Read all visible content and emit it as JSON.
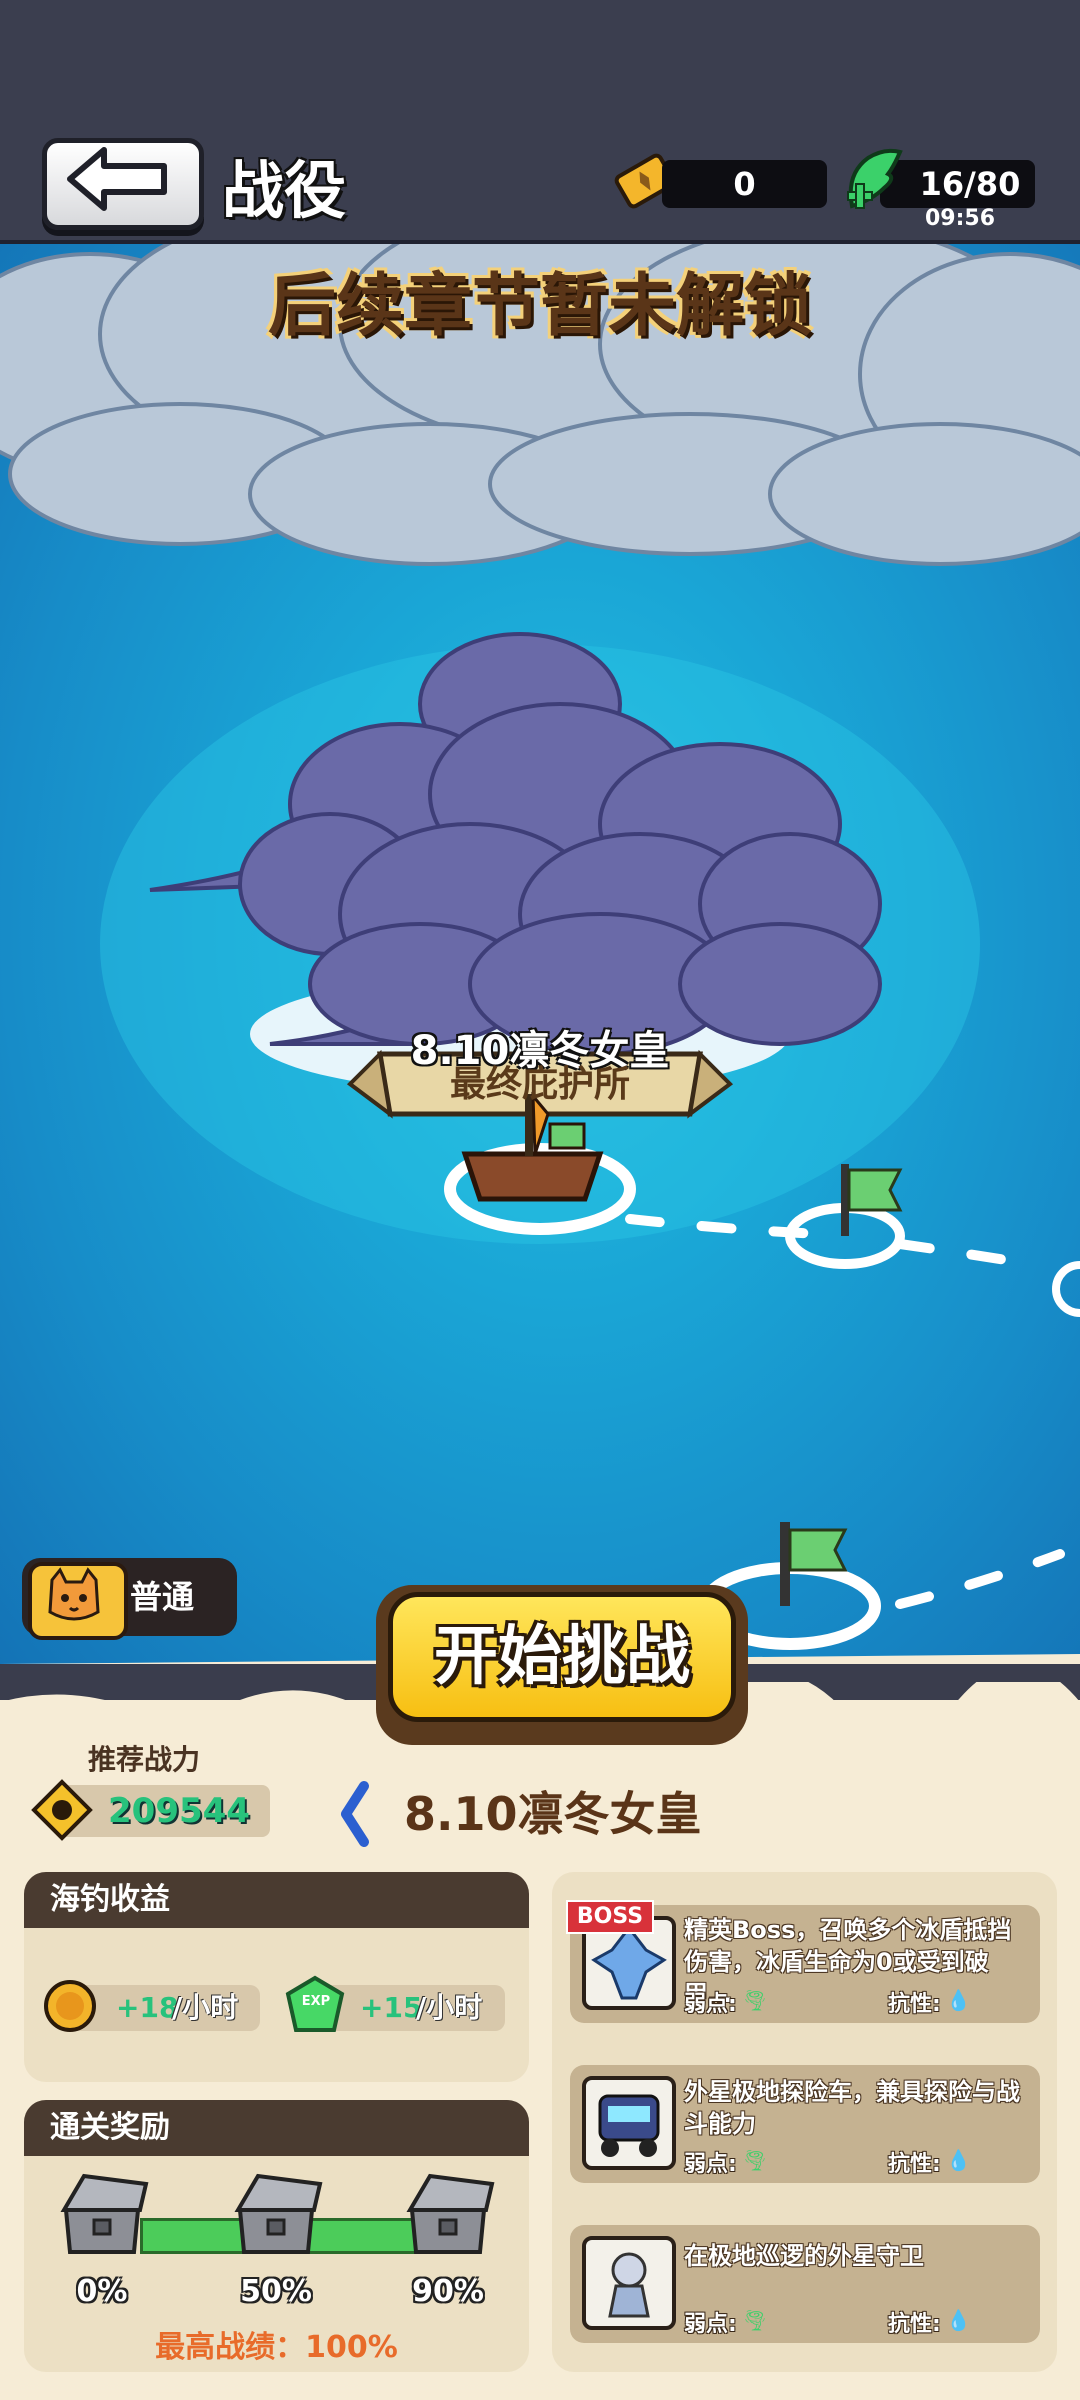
{
  "header": {
    "title": "战役",
    "tickets": "0",
    "energy": "16/80",
    "energy_timer": "09:56"
  },
  "map": {
    "locked_banner": "后续章节暂未解锁",
    "stage_name": "8.10凛冬女皇",
    "stage_subtitle": "最终庇护所"
  },
  "mode": {
    "label": "普通"
  },
  "start_button": {
    "label": "开始挑战"
  },
  "stage_info": {
    "recommended_label": "推荐战力",
    "recommended_power": "209544",
    "stage_name": "8.10凛冬女皇"
  },
  "fishing": {
    "title": "海钓收益",
    "coin_rate": "+18",
    "exp_rate": "+15",
    "per_hour": "/小时",
    "exp_icon_text": "EXP"
  },
  "clear_reward": {
    "title": "通关奖励",
    "milestones": [
      "0%",
      "50%",
      "90%"
    ],
    "best_label": "最高战绩：",
    "best_value": "100%",
    "progress": 1.0
  },
  "enemies": {
    "boss_tag": "BOSS",
    "weak_label": "弱点:",
    "resist_label": "抗性:",
    "list": [
      {
        "desc": "精英Boss，召唤多个冰盾抵挡伤害，冰盾生命为0或受到破甲…",
        "is_boss": true
      },
      {
        "desc": "外星极地探险车，兼具探险与战斗能力",
        "is_boss": false
      },
      {
        "desc": "在极地巡逻的外星守卫",
        "is_boss": false
      }
    ]
  },
  "colors": {
    "sea": "#1aa6d6",
    "panel": "#f6ecd6",
    "button": "#f7bf12",
    "accent_green": "#27c27c",
    "best_orange": "#e86b2a"
  }
}
